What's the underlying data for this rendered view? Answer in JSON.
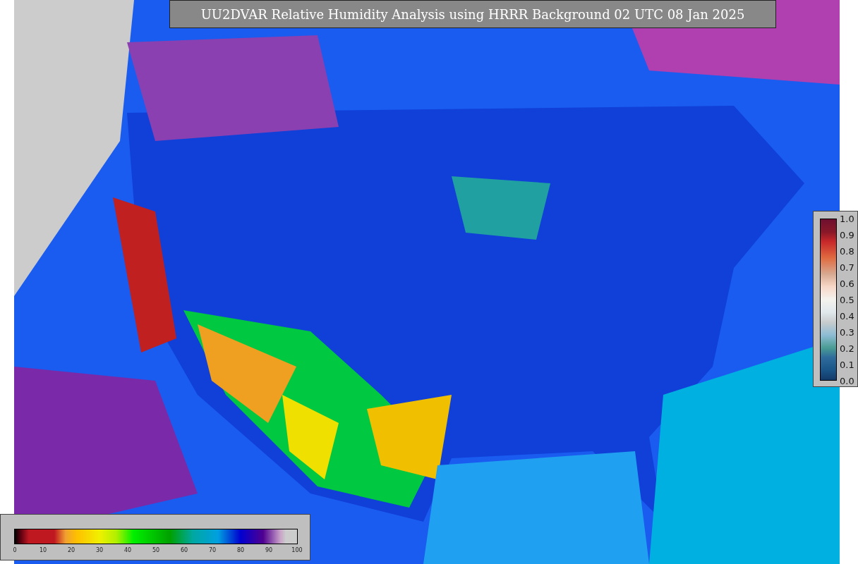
{
  "title": "UU2DVAR Relative Humidity Analysis using HRRR Background 02 UTC 08 Jan 2025",
  "humidity_scale": {
    "ticks": [
      "0",
      "10",
      "20",
      "30",
      "40",
      "50",
      "60",
      "70",
      "80",
      "90",
      "100"
    ]
  },
  "observation_scale": {
    "ticks": [
      "1.0",
      "0.9",
      "0.8",
      "0.7",
      "0.6",
      "0.5",
      "0.4",
      "0.3",
      "0.2",
      "0.1",
      "0.0"
    ]
  }
}
